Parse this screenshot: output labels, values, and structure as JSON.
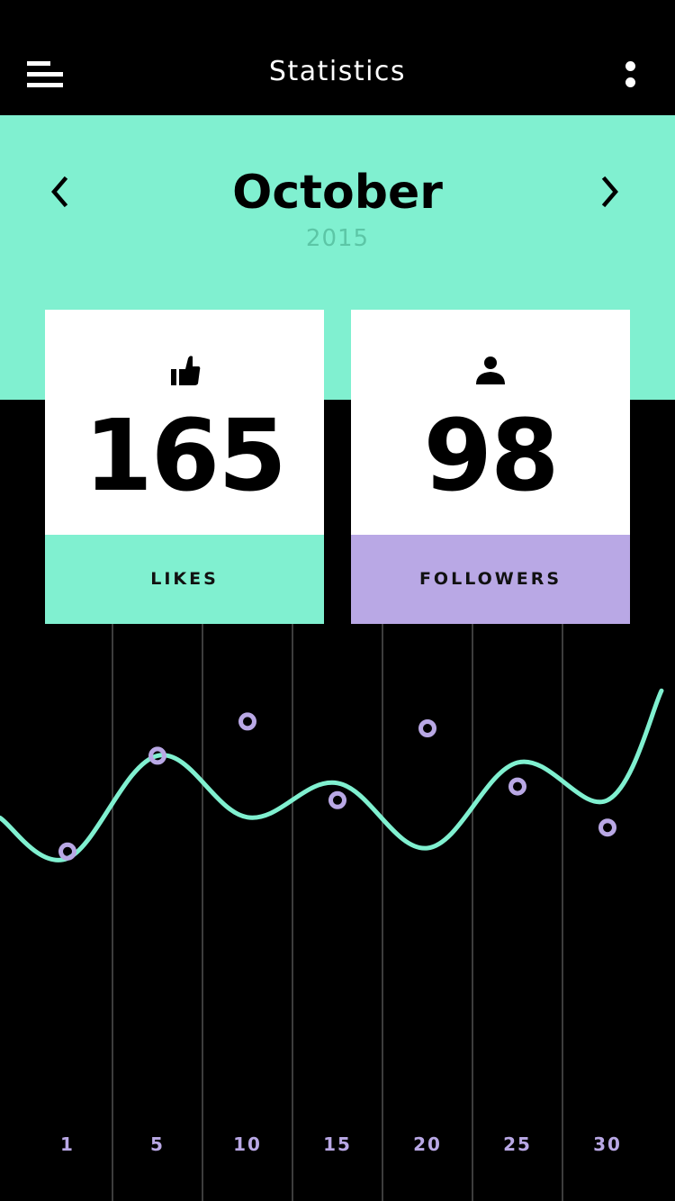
{
  "header": {
    "title": "Statistics",
    "menu_icon": "hamburger-menu-icon",
    "more_icon": "more-vertical-icon"
  },
  "period": {
    "month": "October",
    "year": "2015",
    "prev_icon": "chevron-left-icon",
    "next_icon": "chevron-right-icon"
  },
  "stats": [
    {
      "label": "LIKES",
      "value": "165",
      "icon": "thumbs-up-icon",
      "accent": "#80f0d0"
    },
    {
      "label": "FOLLOWERS",
      "value": "98",
      "icon": "person-icon",
      "accent": "#b9a8e5"
    }
  ],
  "colors": {
    "mint": "#80f0d0",
    "lavender": "#b9a8e5",
    "background": "#000000",
    "card": "#ffffff"
  },
  "chart_data": {
    "type": "line",
    "x_tick_labels": [
      "1",
      "5",
      "10",
      "15",
      "20",
      "25",
      "30"
    ],
    "grid": "vertical",
    "ylim": [
      0,
      100
    ],
    "series": [
      {
        "color": "#80f0d0",
        "points": [
          [
            1,
            42
          ],
          [
            5,
            72
          ],
          [
            10,
            54
          ],
          [
            15,
            64
          ],
          [
            20,
            45
          ],
          [
            25,
            70
          ],
          [
            30,
            59
          ],
          [
            33,
            91
          ]
        ]
      },
      {
        "color": "#b9a8e5",
        "markers": "ring",
        "points": [
          [
            1,
            44
          ],
          [
            5,
            72
          ],
          [
            10,
            82
          ],
          [
            15,
            59
          ],
          [
            20,
            80
          ],
          [
            25,
            63
          ],
          [
            30,
            51
          ]
        ]
      }
    ]
  }
}
